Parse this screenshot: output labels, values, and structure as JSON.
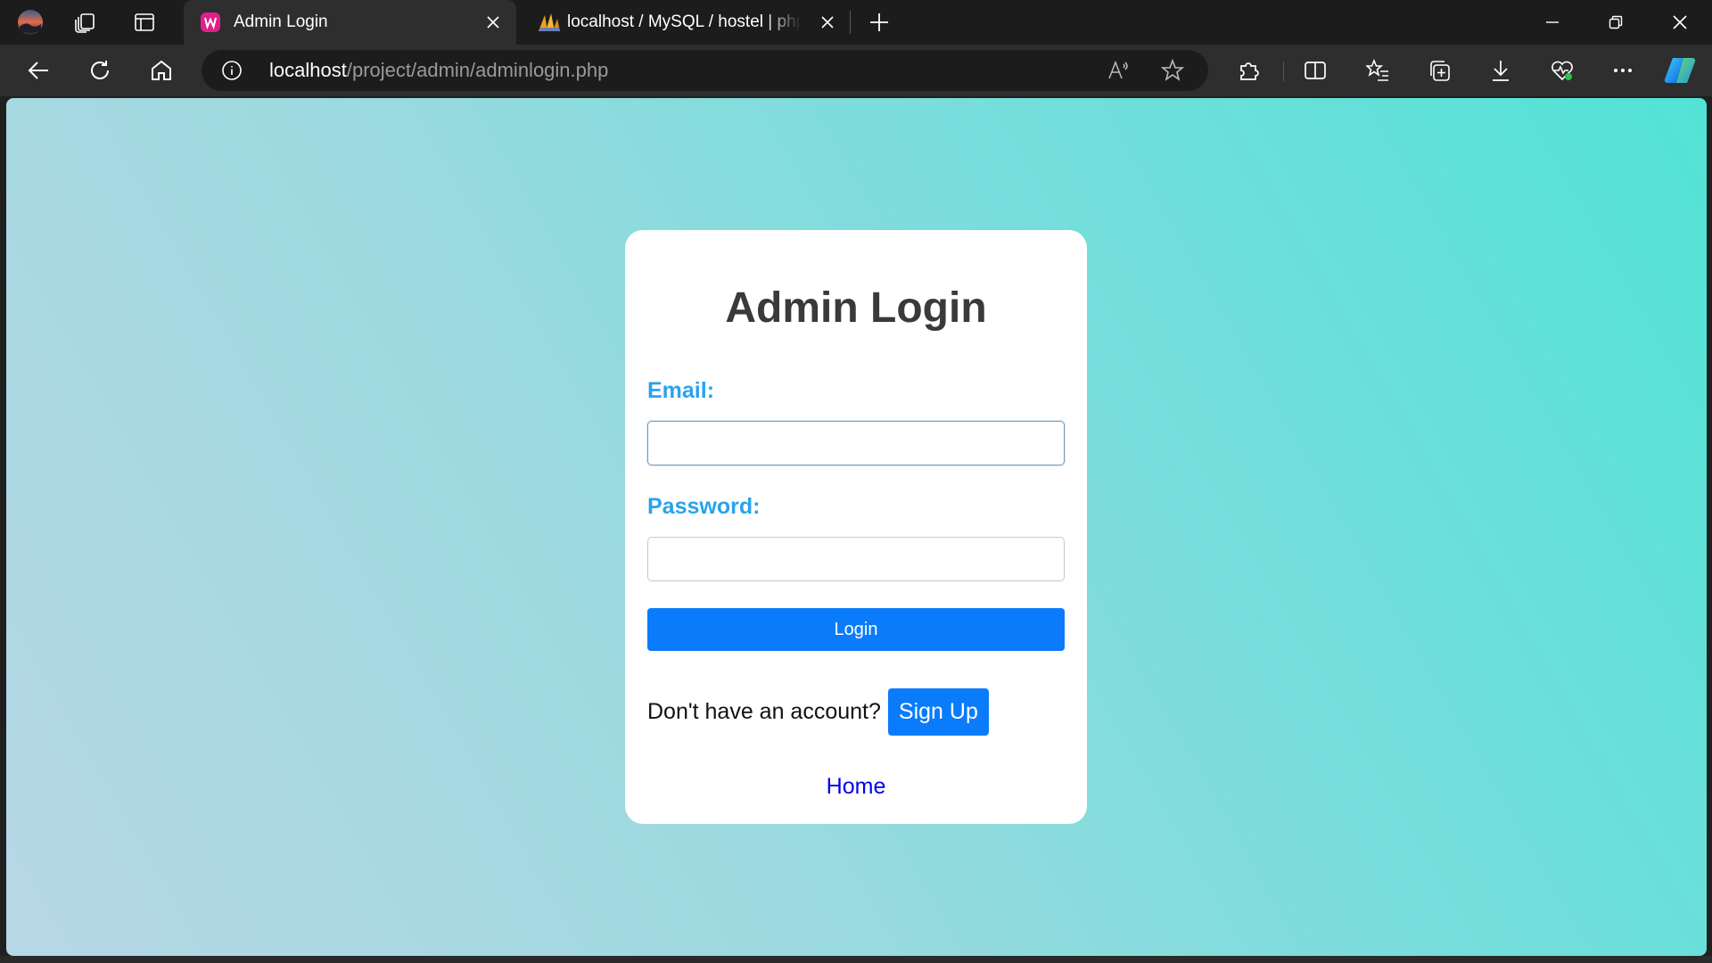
{
  "browser": {
    "tabs": [
      {
        "title": "Admin Login",
        "active": true,
        "icon": "wamp-icon"
      },
      {
        "title": "localhost / MySQL / hostel | phpMyAdmin",
        "active": false,
        "icon": "phpmyadmin-icon"
      }
    ],
    "address": {
      "host": "localhost",
      "path": "/project/admin/adminlogin.php"
    },
    "colors": {
      "frame": "#1c1c1c",
      "toolbar": "#2e2e2e"
    }
  },
  "page": {
    "title": "Admin Login",
    "email_label": "Email:",
    "email_value": "",
    "password_label": "Password:",
    "password_value": "",
    "login_label": "Login",
    "signup_prompt": "Don't have an account?",
    "signup_label": "Sign Up",
    "home_label": "Home",
    "colors": {
      "accent": "#0a7cfb",
      "label": "#2aa2ee",
      "link": "#0000ee",
      "gradient_start": "#b7d7e6",
      "gradient_end": "#52e3d6"
    }
  }
}
